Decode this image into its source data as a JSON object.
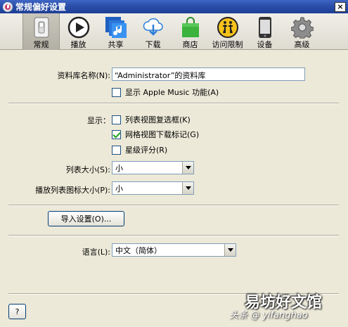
{
  "window": {
    "title": "常规偏好设置",
    "close": "×"
  },
  "toolbar": {
    "items": [
      {
        "label": "常规",
        "icon": "switch-icon"
      },
      {
        "label": "播放",
        "icon": "play-icon"
      },
      {
        "label": "共享",
        "icon": "music-share-icon"
      },
      {
        "label": "下载",
        "icon": "cloud-download-icon"
      },
      {
        "label": "商店",
        "icon": "store-bag-icon"
      },
      {
        "label": "访问限制",
        "icon": "restriction-icon"
      },
      {
        "label": "设备",
        "icon": "phone-icon"
      },
      {
        "label": "高级",
        "icon": "gear-icon"
      }
    ]
  },
  "library": {
    "name_label": "资料库名称(N):",
    "name_value": "“Administrator”的资料库",
    "apple_music_label": "显示 Apple Music 功能(A)",
    "apple_music_checked": false
  },
  "display": {
    "label": "显示：",
    "options": [
      {
        "label": "列表视图复选框(K)",
        "checked": false
      },
      {
        "label": "网格视图下载标记(G)",
        "checked": true
      },
      {
        "label": "星级评分(R)",
        "checked": false
      }
    ]
  },
  "list_size": {
    "label": "列表大小(S):",
    "value": "小"
  },
  "playlist_icon_size": {
    "label": "播放列表图标大小(P):",
    "value": "小"
  },
  "import_button": "导入设置(O)...",
  "language": {
    "label": "语言(L):",
    "value": "中文（简体）"
  },
  "help_button": "?",
  "watermark": {
    "main": "易坊好文馆",
    "sub": "头条 @ yifanghao"
  },
  "colors": {
    "titlebar": "#2a4ea9",
    "background": "#ece9d8",
    "checkmark": "#21a121"
  }
}
